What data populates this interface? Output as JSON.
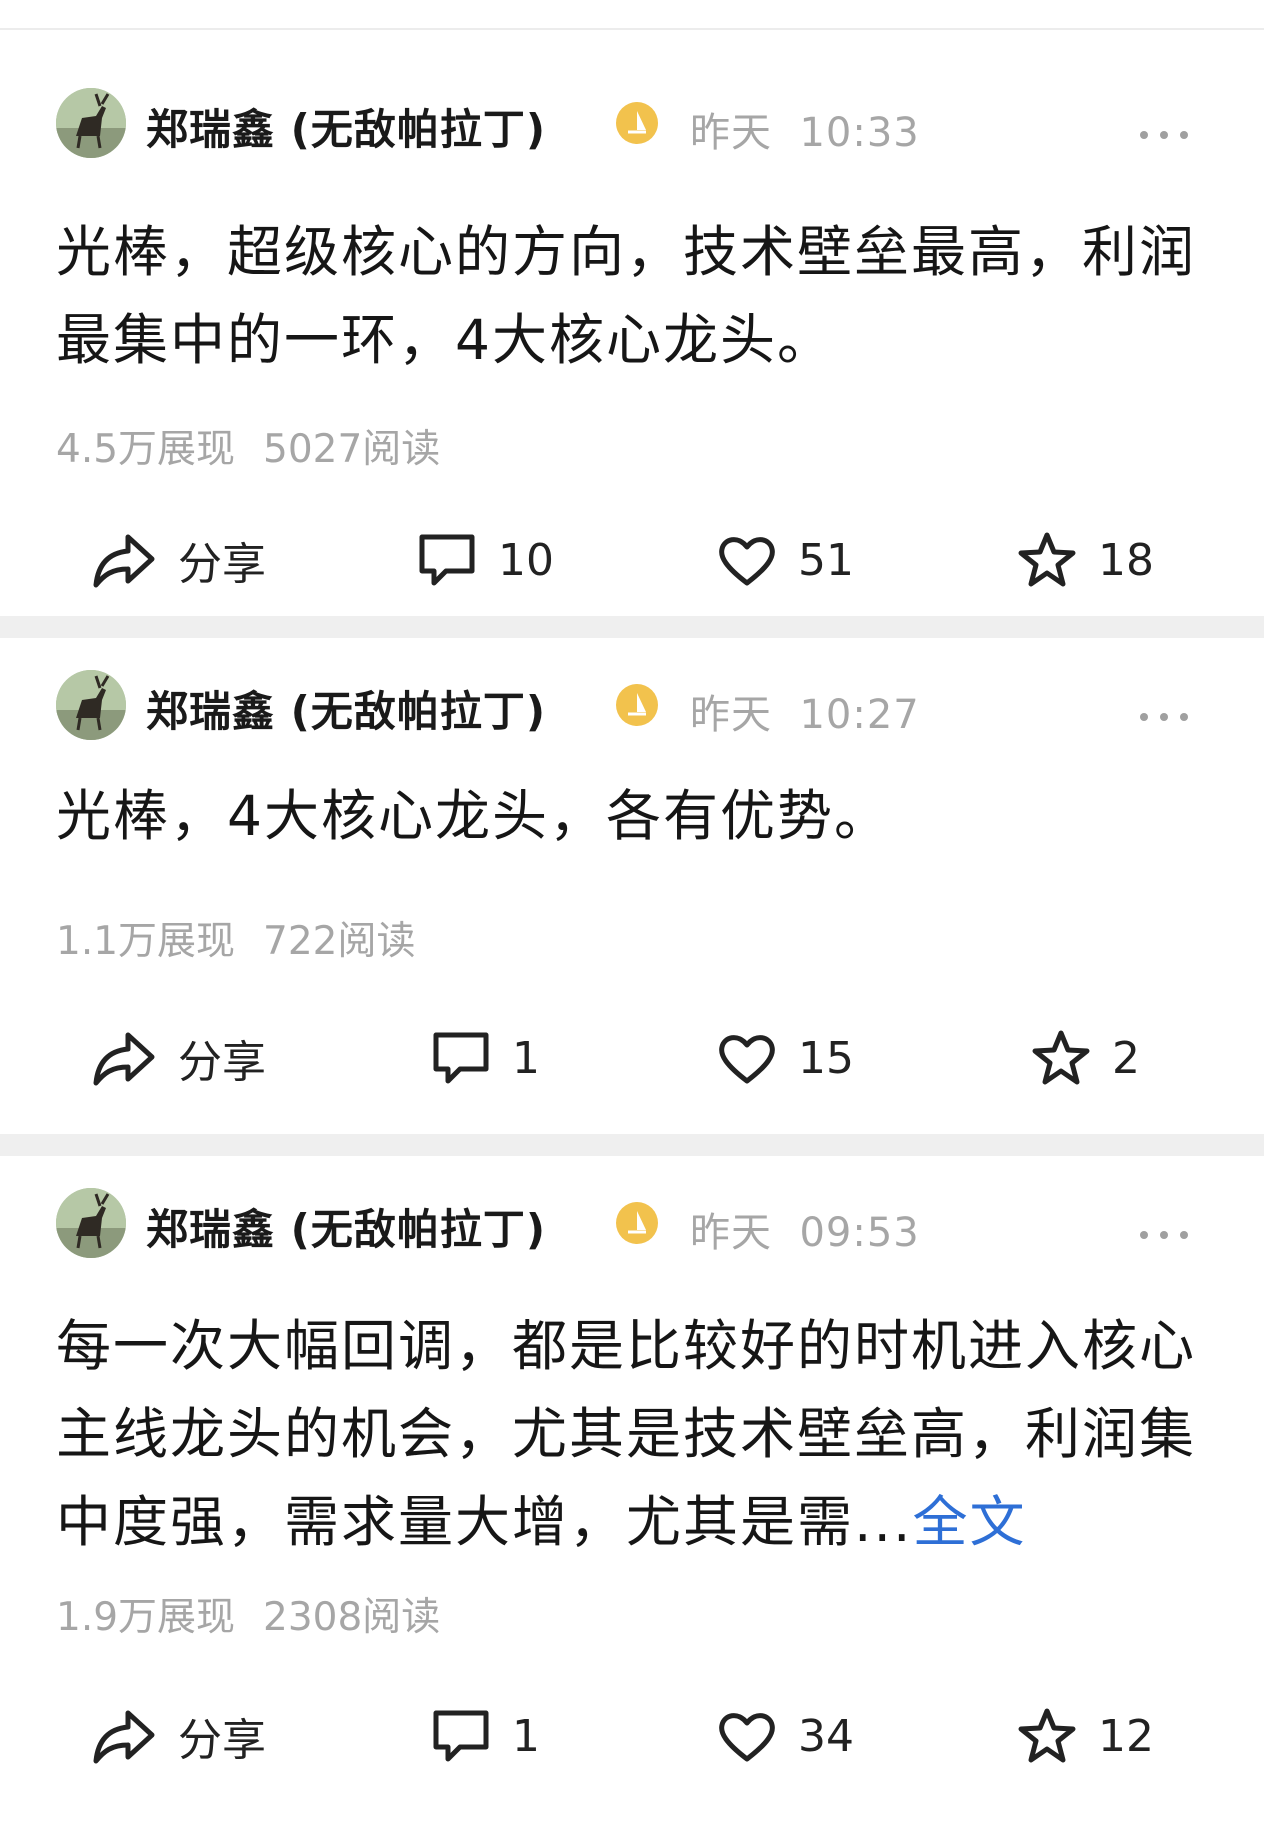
{
  "posts": [
    {
      "author": "郑瑞鑫 (无敌帕拉丁)",
      "time_day": "昨天",
      "time_clock": "10:33",
      "content": "光棒，超级核心的方向，技术壁垒最高，利润最集中的一环，4大核心龙头。",
      "more_link": "",
      "impressions": "4.5万展现",
      "reads": "5027阅读",
      "share_label": "分享",
      "comments": "10",
      "likes": "51",
      "favorites": "18"
    },
    {
      "author": "郑瑞鑫 (无敌帕拉丁)",
      "time_day": "昨天",
      "time_clock": "10:27",
      "content": "光棒，4大核心龙头，各有优势。",
      "more_link": "",
      "impressions": "1.1万展现",
      "reads": "722阅读",
      "share_label": "分享",
      "comments": "1",
      "likes": "15",
      "favorites": "2"
    },
    {
      "author": "郑瑞鑫 (无敌帕拉丁)",
      "time_day": "昨天",
      "time_clock": "09:53",
      "content": "每一次大幅回调，都是比较好的时机进入核心主线龙头的机会，尤其是技术壁垒高，利润集中度强，需求量大增，尤其是需...",
      "more_link": "全文",
      "impressions": "1.9万展现",
      "reads": "2308阅读",
      "share_label": "分享",
      "comments": "1",
      "likes": "34",
      "favorites": "12"
    }
  ],
  "colors": {
    "link": "#2e6fd6",
    "meta": "#a6a6a6",
    "badge": "#f2c24d",
    "separator": "#efefef"
  },
  "icons": {
    "share": "share-arrow-icon",
    "comment": "comment-bubble-icon",
    "like": "heart-icon",
    "favorite": "star-icon",
    "more": "more-dots-icon",
    "badge": "verified-badge-icon"
  }
}
